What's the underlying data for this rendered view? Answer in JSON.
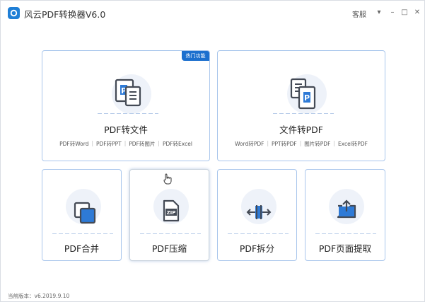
{
  "app": {
    "title": "风云PDF转换器V6.0",
    "customer_service": "客服",
    "dropdown_label": "▾",
    "minimize_label": "–",
    "maximize_label": "□",
    "close_label": "✕"
  },
  "cards": {
    "pdf_to_file": {
      "title": "PDF转文件",
      "badge": "热门功能",
      "subitems": [
        "PDF转Word",
        "PDF转PPT",
        "PDF转图片",
        "PDF转Excel"
      ]
    },
    "file_to_pdf": {
      "title": "文件转PDF",
      "subitems": [
        "Word转PDF",
        "PPT转PDF",
        "图片转PDF",
        "Excel转PDF"
      ]
    },
    "merge": {
      "title": "PDF合并"
    },
    "compress": {
      "title": "PDF压缩",
      "icon_text": "ZIP"
    },
    "split": {
      "title": "PDF拆分"
    },
    "extract": {
      "title": "PDF页面提取"
    }
  },
  "status": {
    "version": "当前版本：v6.2019.9.10"
  },
  "colors": {
    "accent": "#1c6fce",
    "card_border": "#a9c6ec",
    "icon_dark": "#444a55"
  }
}
